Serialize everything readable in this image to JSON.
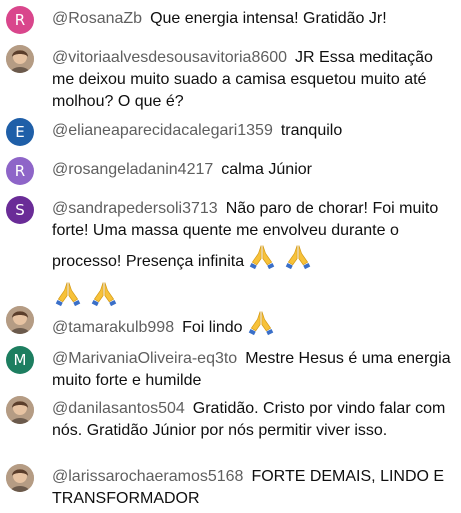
{
  "colors": {
    "author": "#5f5f5f",
    "message": "#0f0f0f",
    "background": "#ffffff"
  },
  "messages": [
    {
      "author": "@RosanaZb",
      "text": "Que energia intensa! Gratidão Jr!",
      "avatar": {
        "type": "letter",
        "letter": "R",
        "color": "#d9468c"
      }
    },
    {
      "author": "@vitoriaalvesdesousavitoria8600",
      "text": "JR Essa meditação me deixou muito suado a camisa esquetou muito até molhou? O que é?",
      "avatar": {
        "type": "photo",
        "icon": "user-photo"
      }
    },
    {
      "author": "@elianeaparecidacalegari1359",
      "text": "tranquilo",
      "avatar": {
        "type": "letter",
        "letter": "E",
        "color": "#1f5fa8"
      }
    },
    {
      "author": "@rosangeladanin4217",
      "text": "calma Júnior",
      "avatar": {
        "type": "letter",
        "letter": "R",
        "color": "#8e65c8"
      }
    },
    {
      "author": "@sandrapedersoli3713",
      "text": "Não paro de chorar! Foi muito forte! Uma massa quente me envolveu durante o processo! Presença infinita",
      "avatar": {
        "type": "letter",
        "letter": "S",
        "color": "#6a2c97"
      },
      "emoji": "praying-hands-icon"
    },
    {
      "author": "@tamarakulb998",
      "text": "Foi lindo",
      "avatar": {
        "type": "photo",
        "icon": "user-photo"
      },
      "emoji": "praying-hands-icon"
    },
    {
      "author": "@MarivaniaOliveira-eq3to",
      "text": "Mestre Hesus é uma energia muito forte e humilde",
      "avatar": {
        "type": "letter",
        "letter": "M",
        "color": "#1d7e60"
      }
    },
    {
      "author": "@danilasantos504",
      "text": "Gratidão. Cristo por vindo falar com nós. Gratidão Júnior por nós permitir viver isso.",
      "avatar": {
        "type": "photo",
        "icon": "user-photo"
      }
    },
    {
      "author": "@larissarochaeramos5168",
      "text": "FORTE DEMAIS, LINDO E TRANSFORMADOR",
      "avatar": {
        "type": "photo",
        "icon": "user-photo"
      }
    }
  ]
}
